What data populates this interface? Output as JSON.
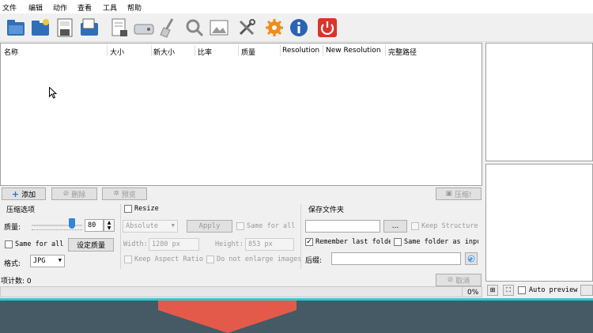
{
  "menu": [
    "文件",
    "编辑",
    "动作",
    "查看",
    "工具",
    "帮助"
  ],
  "toolbar": {
    "icons": [
      "open-image-icon",
      "open-folder-icon",
      "save-icon",
      "save-all-icon",
      "remove-icon",
      "clear-drive-icon",
      "clean-brush-icon",
      "search-icon",
      "image-view-icon",
      "tools-icon",
      "settings-icon",
      "info-icon",
      "power-icon"
    ]
  },
  "list": {
    "columns": [
      "名称",
      "大小",
      "新大小",
      "比率",
      "质量",
      "Resolution",
      "New Resolution",
      "完整路径"
    ]
  },
  "buttons": {
    "add": "添加",
    "delete": "删除",
    "preview": "预览",
    "compress": "压缩!",
    "cancel": "取消"
  },
  "compression": {
    "group_title": "压缩选项",
    "quality_label": "质量:",
    "quality_value": "80",
    "quality_fraction": 0.8,
    "same_for_all": "Same for all",
    "set_quality_button": "设定质量",
    "format_label": "格式:",
    "format_value": "JPG"
  },
  "resize": {
    "checkbox_label": "Resize",
    "mode_value": "Absolute",
    "apply_button": "Apply",
    "same_for_all": "Same for all",
    "width_label": "Width:",
    "width_value": "1280 px",
    "height_label": "Height:",
    "height_value": "853 px",
    "keep_aspect": "Keep Aspect Ratio",
    "no_enlarge": "Do not enlarge images"
  },
  "output": {
    "group_title": "保存文件夹",
    "folder_value": "",
    "browse_label": "...",
    "keep_structure": "Keep Structure",
    "remember_last_folder": "Remember last folder",
    "same_folder_as_input": "Same folder as input",
    "suffix_label": "后缀:",
    "suffix_value": ""
  },
  "status": {
    "item_count": "项计数: 0",
    "progress_text": "0%",
    "progress_fraction": 0
  },
  "preview_panel": {
    "auto_preview": "Auto preview"
  },
  "colors": {
    "bottom_bg": "#455a64",
    "accent_line": "#36c4d4",
    "arrow": "#e35a4b",
    "power": "#d9352b",
    "settings": "#f08c1a",
    "info": "#2a63b5"
  }
}
